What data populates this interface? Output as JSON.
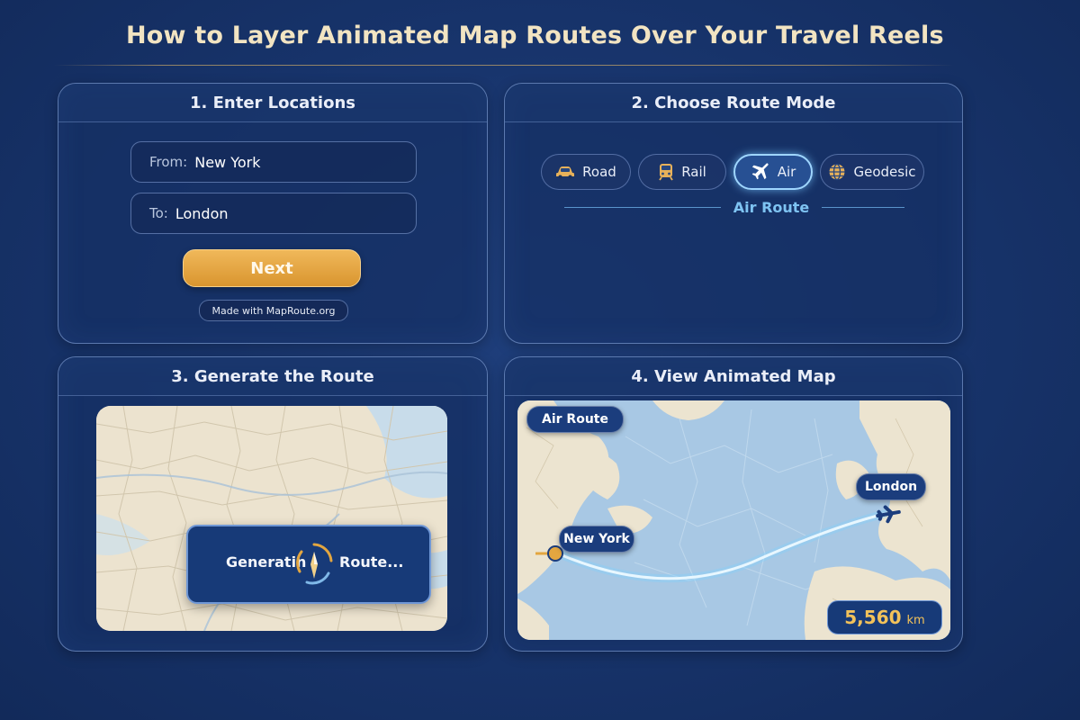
{
  "title": "How to Layer Animated Map Routes Over Your Travel Reels",
  "colors": {
    "background": "#17336a",
    "accent_gold": "#e3a640",
    "route_glow": "#9fd6ff"
  },
  "step1": {
    "header": "1. Enter Locations",
    "from_label": "From:",
    "from_value": "New York",
    "to_label": "To:",
    "to_value": "London",
    "next_label": "Next",
    "badge": "Made with MapRoute.org"
  },
  "step2": {
    "header": "2. Choose Route Mode",
    "modes": [
      {
        "label": "Road",
        "icon": "car-icon",
        "active": false
      },
      {
        "label": "Rail",
        "icon": "train-icon",
        "active": false
      },
      {
        "label": "Air",
        "icon": "plane-icon",
        "active": true
      },
      {
        "label": "Geodesic",
        "icon": "globe-icon",
        "active": false
      }
    ],
    "selected_caption": "Air Route"
  },
  "step3": {
    "header": "3. Generate the Route",
    "status_part1": "Generatin",
    "status_part2": "Route..."
  },
  "step4": {
    "header": "4. View Animated Map",
    "route_chip": "Air Route",
    "origin": "New York",
    "destination": "London",
    "distance_value": "5,560",
    "distance_unit": "km"
  }
}
